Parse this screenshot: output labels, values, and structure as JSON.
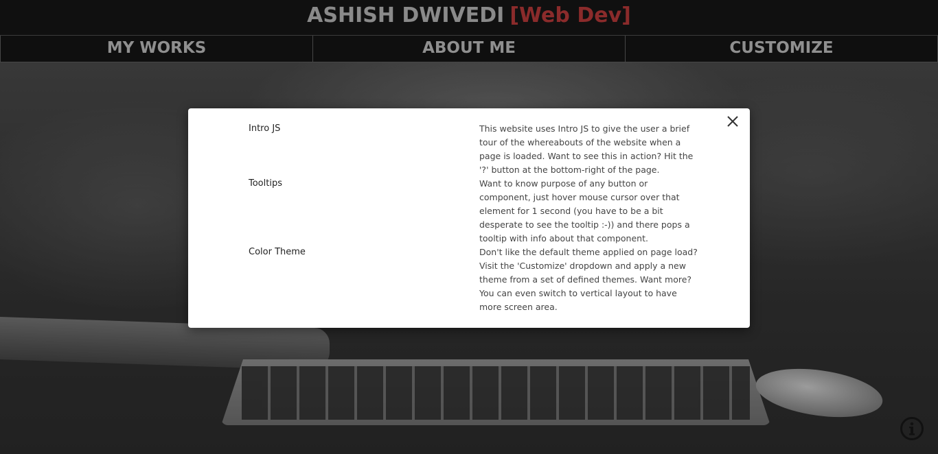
{
  "header": {
    "name": "ASHISH DWIVEDI",
    "role": "[Web Dev]"
  },
  "nav": {
    "items": [
      {
        "label": "MY WORKS"
      },
      {
        "label": "ABOUT ME"
      },
      {
        "label": "CUSTOMIZE"
      }
    ]
  },
  "modal": {
    "close_icon": "close-icon",
    "features": [
      {
        "title": "Intro JS",
        "description": "This website uses Intro JS to give the user a brief tour of the whereabouts of the website when a page is loaded. Want to see this in action? Hit the '?' button at the bottom-right of the page."
      },
      {
        "title": "Tooltips",
        "description": "Want to know purpose of any button or component, just hover mouse cursor over that element for 1 second (you have to be a bit desperate to see the tooltip :-)) and there pops a tooltip with info about that component."
      },
      {
        "title": "Color Theme",
        "description": "Don't like the default theme applied on page load? Visit the 'Customize' dropdown and apply a new theme from a set of defined themes. Want more? You can even switch to vertical layout to have more screen area."
      }
    ]
  },
  "info_button": {
    "icon": "info-icon"
  },
  "colors": {
    "header_bg": "#101010",
    "title_text": "#8a8a8a",
    "accent_red": "#8b2b2b",
    "nav_text": "#8f8f8f",
    "modal_bg": "#ffffff"
  }
}
